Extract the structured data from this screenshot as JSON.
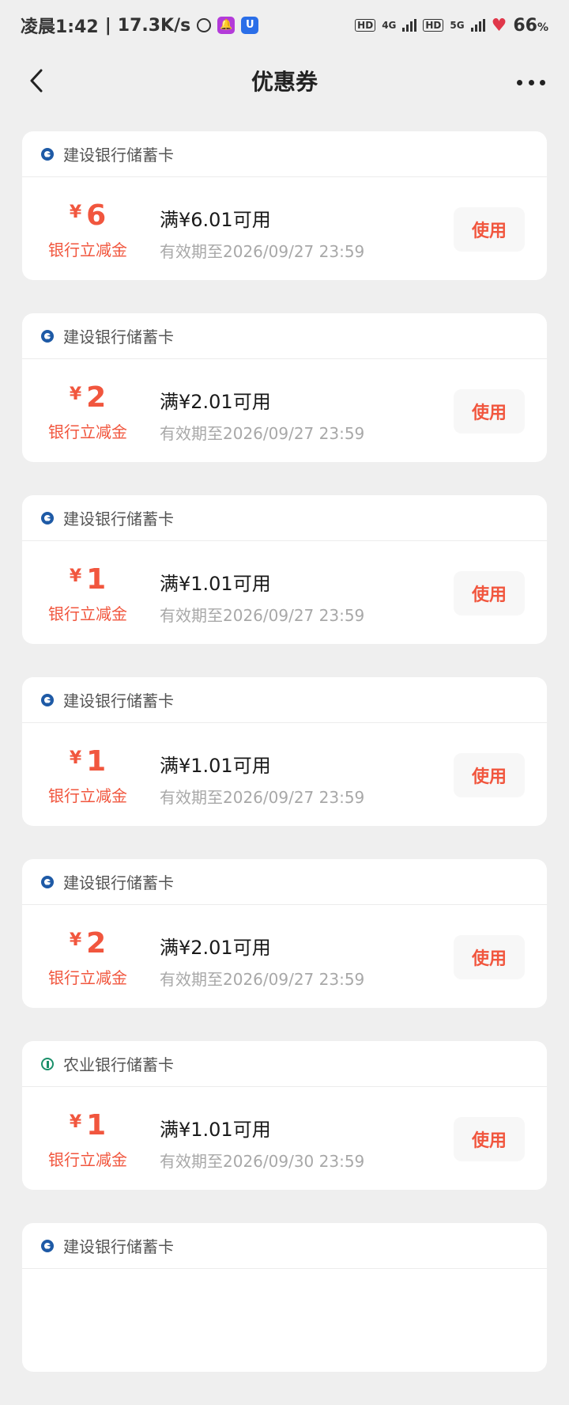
{
  "status_bar": {
    "time": "凌晨1:42",
    "speed": "17.3K/s",
    "badge_purple": "🔔",
    "badge_blue": "U",
    "hd1": "HD",
    "net1": "4G",
    "hd2": "HD",
    "net2": "5G",
    "battery": "66",
    "battery_unit": "%"
  },
  "nav": {
    "title": "优惠券"
  },
  "coupons": [
    {
      "bank": "建设银行储蓄卡",
      "bank_type": "ccb",
      "amount": "6",
      "sub": "银行立减金",
      "condition": "满¥6.01可用",
      "expiry": "有效期至2026/09/27 23:59",
      "button": "使用"
    },
    {
      "bank": "建设银行储蓄卡",
      "bank_type": "ccb",
      "amount": "2",
      "sub": "银行立减金",
      "condition": "满¥2.01可用",
      "expiry": "有效期至2026/09/27 23:59",
      "button": "使用"
    },
    {
      "bank": "建设银行储蓄卡",
      "bank_type": "ccb",
      "amount": "1",
      "sub": "银行立减金",
      "condition": "满¥1.01可用",
      "expiry": "有效期至2026/09/27 23:59",
      "button": "使用"
    },
    {
      "bank": "建设银行储蓄卡",
      "bank_type": "ccb",
      "amount": "1",
      "sub": "银行立减金",
      "condition": "满¥1.01可用",
      "expiry": "有效期至2026/09/27 23:59",
      "button": "使用"
    },
    {
      "bank": "建设银行储蓄卡",
      "bank_type": "ccb",
      "amount": "2",
      "sub": "银行立减金",
      "condition": "满¥2.01可用",
      "expiry": "有效期至2026/09/27 23:59",
      "button": "使用"
    },
    {
      "bank": "农业银行储蓄卡",
      "bank_type": "abc",
      "amount": "1",
      "sub": "银行立减金",
      "condition": "满¥1.01可用",
      "expiry": "有效期至2026/09/30 23:59",
      "button": "使用"
    },
    {
      "bank": "建设银行储蓄卡",
      "bank_type": "ccb",
      "amount": "",
      "sub": "",
      "condition": "",
      "expiry": "",
      "button": ""
    }
  ],
  "currency_symbol": "¥",
  "colors": {
    "accent": "#f1563e",
    "background": "#efefef",
    "ccb_blue": "#1e5aa6",
    "abc_green": "#1a8f6a"
  }
}
